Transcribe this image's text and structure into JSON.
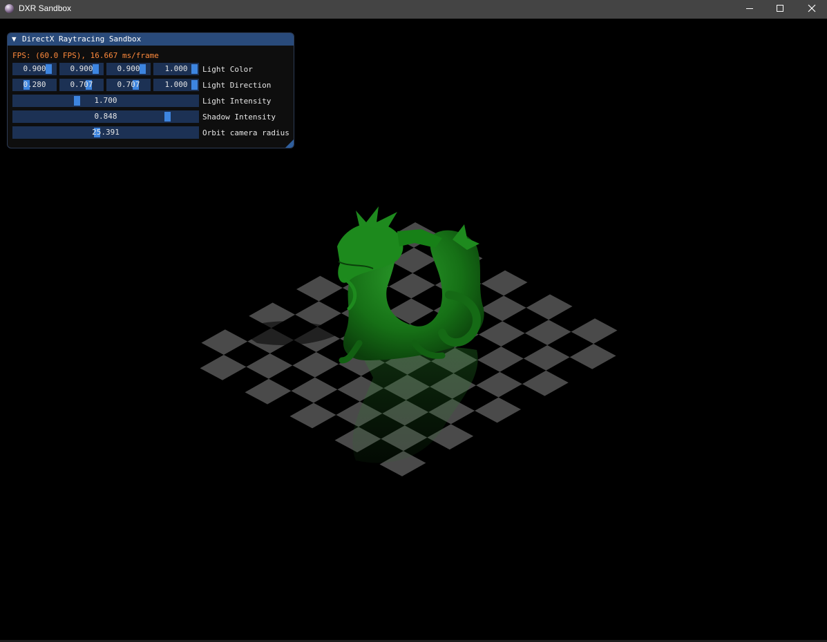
{
  "window": {
    "title": "DXR Sandbox",
    "controls": [
      "minimize-icon",
      "maximize-icon",
      "close-icon"
    ]
  },
  "panel": {
    "title": "DirectX Raytracing Sandbox",
    "fps_text": "FPS: (60.0 FPS), 16.667 ms/frame",
    "rows": {
      "light_color": {
        "label": "Light Color",
        "values": [
          {
            "text": "0.900",
            "fraction": 0.9
          },
          {
            "text": "0.900",
            "fraction": 0.9
          },
          {
            "text": "0.900",
            "fraction": 0.9
          },
          {
            "text": "1.000",
            "fraction": 1.0
          }
        ]
      },
      "light_direction": {
        "label": "Light Direction",
        "values": [
          {
            "text": "0.280",
            "fraction": 0.28
          },
          {
            "text": "0.707",
            "fraction": 0.707
          },
          {
            "text": "0.707",
            "fraction": 0.707
          },
          {
            "text": "1.000",
            "fraction": 1.0
          }
        ]
      },
      "light_intensity": {
        "label": "Light Intensity",
        "text": "1.700",
        "fraction": 0.34
      },
      "shadow_intensity": {
        "label": "Shadow Intensity",
        "text": "0.848",
        "fraction": 0.848
      },
      "orbit_radius": {
        "label": "Orbit camera radius",
        "text": "25.391",
        "fraction": 0.45
      }
    }
  },
  "colors": {
    "title_bar": "#444444",
    "panel_header": "#294a7a",
    "slider_bg": "#1c3154",
    "slider_grab": "#3d85e0",
    "fps_text": "#ff8a3c",
    "dragon": "#1b7a1b",
    "floor_tile": "#4a4a4a"
  }
}
